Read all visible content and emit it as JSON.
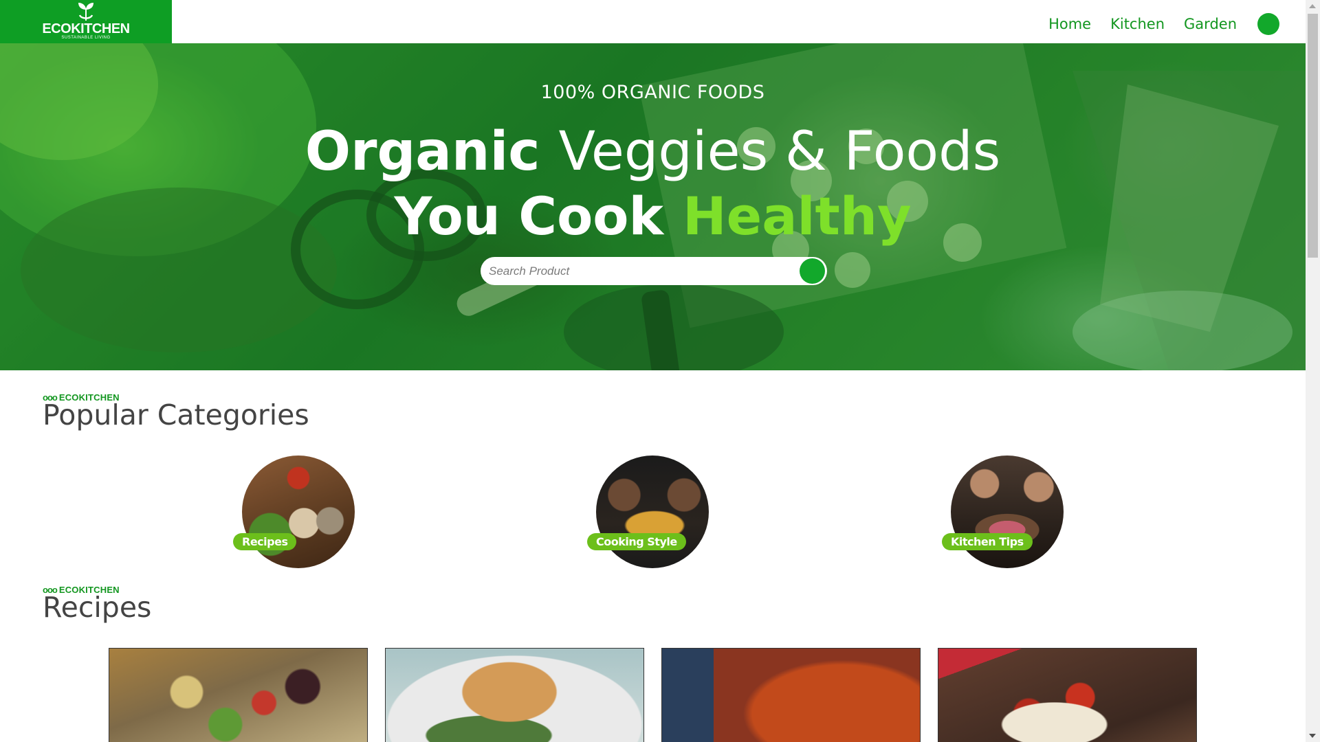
{
  "brand": {
    "name": "ECOKITCHEN",
    "tagline": "SUSTAINABLE LIVING",
    "color": "#0e9e24"
  },
  "nav": {
    "items": [
      {
        "label": "Home"
      },
      {
        "label": "Kitchen"
      },
      {
        "label": "Garden"
      }
    ],
    "accent_color": "#12961f"
  },
  "hero": {
    "kicker": "100% ORGANIC FOODS",
    "line1_bold": "Organic",
    "line1_rest": "Veggies & Foods",
    "line2_main": "You Cook",
    "line2_accent": "Healthy",
    "accent_color": "#7ee02a",
    "search": {
      "placeholder": "Search Product",
      "value": ""
    }
  },
  "categories_section": {
    "kicker": "ECOKITCHEN",
    "kicker_icon": "ooo",
    "title": "Popular Categories",
    "items": [
      {
        "label": "Recipes",
        "image": "vegetables-basket-photo"
      },
      {
        "label": "Cooking Style",
        "image": "chef-plating-photo"
      },
      {
        "label": "Kitchen Tips",
        "image": "chef-board-photo"
      }
    ],
    "tag_color": "#6cbf1b"
  },
  "recipes_section": {
    "kicker": "ECOKITCHEN",
    "kicker_icon": "ooo",
    "title": "Recipes",
    "cards": [
      {
        "image": "quinoa-salad-photo"
      },
      {
        "image": "stuffed-chicken-photo"
      },
      {
        "image": "chickpea-stew-photo"
      },
      {
        "image": "stuffed-mushroom-photo"
      }
    ]
  }
}
